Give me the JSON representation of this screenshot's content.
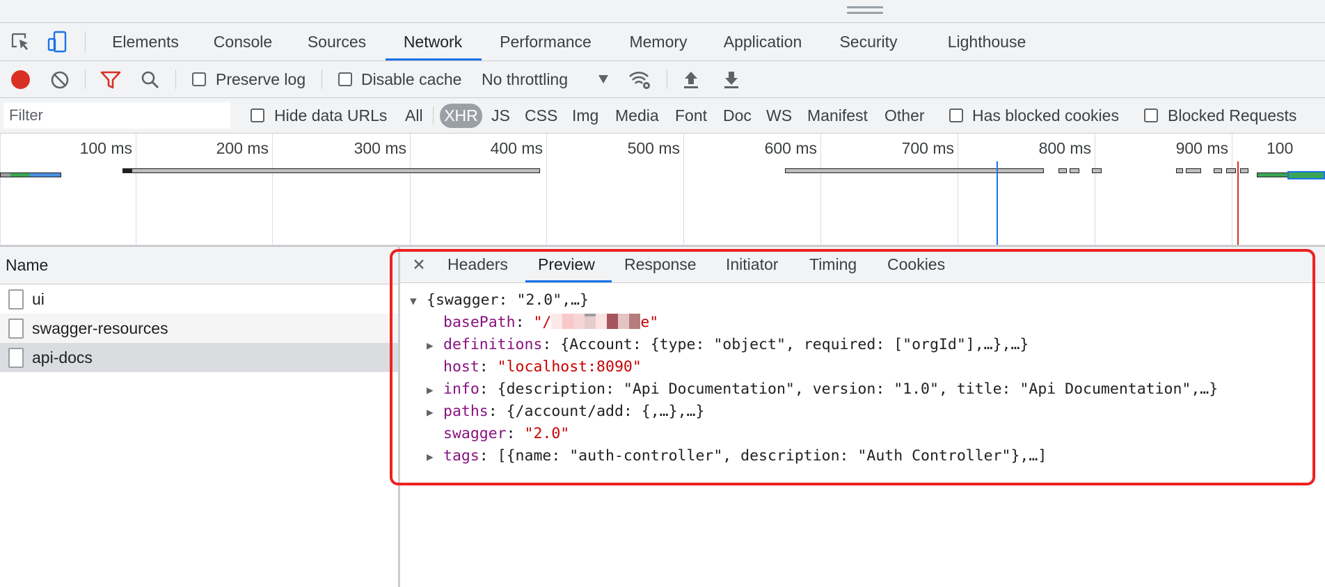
{
  "main_tabs": [
    {
      "label": "Elements"
    },
    {
      "label": "Console"
    },
    {
      "label": "Sources"
    },
    {
      "label": "Network"
    },
    {
      "label": "Performance"
    },
    {
      "label": "Memory"
    },
    {
      "label": "Application"
    },
    {
      "label": "Security"
    },
    {
      "label": "Lighthouse"
    }
  ],
  "active_tab": "Network",
  "toolbar": {
    "preserve_log": "Preserve log",
    "disable_cache": "Disable cache",
    "throttling": "No throttling"
  },
  "filter": {
    "placeholder": "Filter",
    "hide_data_urls": "Hide data URLs",
    "types": [
      "All",
      "XHR",
      "JS",
      "CSS",
      "Img",
      "Media",
      "Font",
      "Doc",
      "WS",
      "Manifest",
      "Other"
    ],
    "active_type": "XHR",
    "has_blocked_cookies": "Has blocked cookies",
    "blocked_requests": "Blocked Requests"
  },
  "overview": {
    "ticks": [
      "100 ms",
      "200 ms",
      "300 ms",
      "400 ms",
      "500 ms",
      "600 ms",
      "700 ms",
      "800 ms",
      "900 ms",
      "100"
    ]
  },
  "requests": {
    "header": "Name",
    "items": [
      "ui",
      "swagger-resources",
      "api-docs"
    ],
    "selected": "api-docs"
  },
  "detail_tabs": [
    "Headers",
    "Preview",
    "Response",
    "Initiator",
    "Timing",
    "Cookies"
  ],
  "active_detail_tab": "Preview",
  "preview": {
    "root": "{swagger: \"2.0\",…}",
    "basePath_key": "basePath",
    "basePath_start": "\"/",
    "basePath_end": "e\"",
    "definitions_key": "definitions",
    "definitions_val": "{Account: {type: \"object\", required: [\"orgId\"],…},…}",
    "host_key": "host",
    "host_val": "\"localhost:8090\"",
    "info_key": "info",
    "info_val": "{description: \"Api Documentation\", version: \"1.0\", title: \"Api Documentation\",…}",
    "paths_key": "paths",
    "paths_val": "{/account/add: {,…},…}",
    "swagger_key": "swagger",
    "swagger_val": "\"2.0\"",
    "tags_key": "tags",
    "tags_val": "[{name: \"auth-controller\", description: \"Auth Controller\"},…]"
  },
  "colors": {
    "accent": "#1a73e8",
    "record": "#d93025",
    "key": "#881280",
    "string": "#c80000",
    "annotation": "#ee2222"
  }
}
